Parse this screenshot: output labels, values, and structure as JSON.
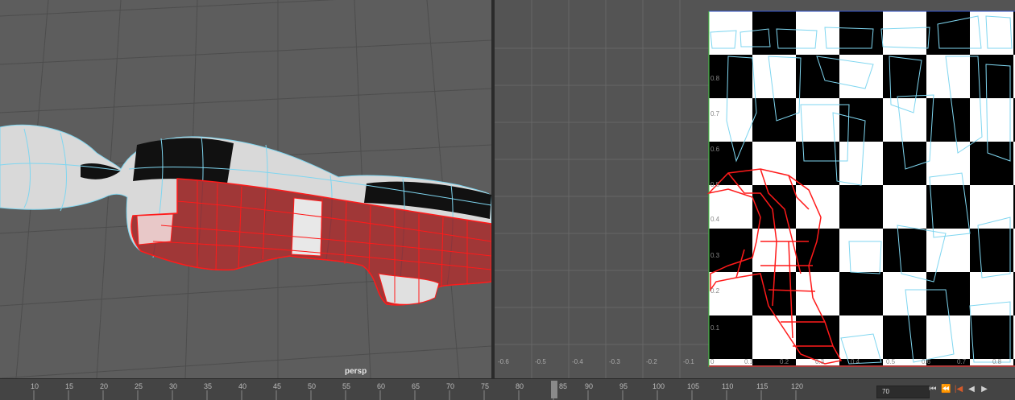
{
  "viewport": {
    "camera_label": "persp"
  },
  "uv_editor": {
    "u_labels_negative": [
      "-0.6",
      "-0.5",
      "-0.4",
      "-0.3",
      "-0.2",
      "-0.1"
    ],
    "u_labels_positive": [
      "0",
      "0.1",
      "0.2",
      "0.3",
      "0.4",
      "0.5",
      "0.6",
      "0.7",
      "0.8"
    ],
    "v_labels": [
      "0.1",
      "0.2",
      "0.3",
      "0.4",
      "0.5",
      "0.6",
      "0.7",
      "0.8"
    ]
  },
  "timeline": {
    "ticks": [
      "10",
      "15",
      "20",
      "25",
      "30",
      "35",
      "40",
      "45",
      "50",
      "55",
      "60",
      "65",
      "70",
      "75",
      "80",
      "85",
      "90",
      "95",
      "100",
      "105",
      "110",
      "115",
      "120"
    ],
    "current_frame": "70",
    "playhead_frame": "78"
  },
  "transport": {
    "first_icon": "go-to-start-icon",
    "prev_key_icon": "step-back-key-icon",
    "prev_frame_icon": "step-back-frame-icon",
    "play_back_icon": "play-backward-icon",
    "play_icon": "play-forward-icon"
  },
  "colors": {
    "selection_red": "#ff1a1a",
    "wire_cyan": "#7fd6f0",
    "viewport_bg": "#5d5d5d",
    "uv_bg": "#545454"
  }
}
